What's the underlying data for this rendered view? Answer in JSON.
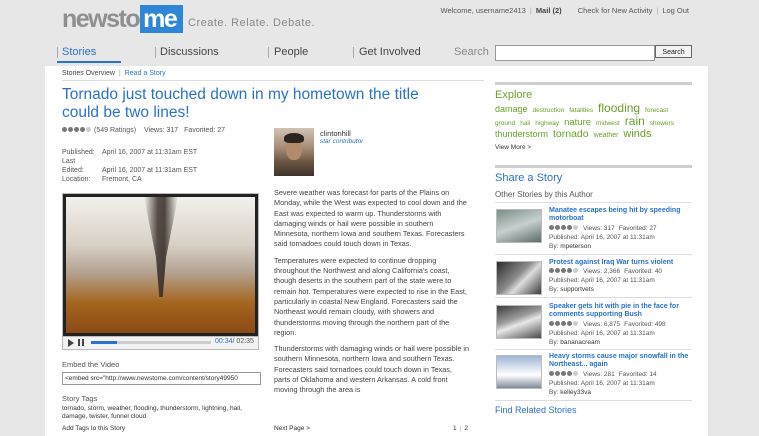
{
  "header": {
    "logo_part1": "newsto",
    "logo_part2": "me",
    "tagline": "Create. Relate. Debate.",
    "welcome": "Welcome, username2413",
    "mail": "Mail (2)",
    "check_activity": "Check for New Activity",
    "logout": "Log Out"
  },
  "nav": {
    "items": [
      "Stories",
      "Discussions",
      "People",
      "Get Involved"
    ],
    "search_label": "Search",
    "search_button": "Search",
    "search_value": ""
  },
  "breadcrumb": {
    "overview": "Stories Overview",
    "read": "Read a Story"
  },
  "article": {
    "title": "Tornado just touched down in my hometown the title could be two lines!",
    "rating_stars": 4,
    "ratings": "(549 Ratings)",
    "views": "Views: 317",
    "favorited": "Favorited: 27",
    "published_label": "Published:",
    "published": "April 16, 2007 at 11:31am EST",
    "edited_label": "Last Edited:",
    "edited": "April 16, 2007 at 11:31am EST",
    "location_label": "Location:",
    "location": "Fremont, CA",
    "author_name": "clintonhill",
    "author_title": "star contributor",
    "paragraphs": [
      "Severe weather was forecast for parts of the Plains on Monday, while the West was expected to cool down and the East was expected to warm up. Thunderstorms with damaging winds or hail were possible in southern Minnesota, northern Iowa and southern Texas. Forecasters said tornadoes could touch down in Texas.",
      "Temperatures were expected to continue dropping throughout the Northwest and along California's coast, though deserts in the southern part of the state were to remain hot. Temperatures were expected to rise in the East, particularly in coastal New England. Forecasters said the Northeast would remain cloudy, with showers and thunderstorms moving through the northern part of the region.",
      "Thunderstorms with damaging winds or hail were possible in southern Minnesota, northern Iowa and southern Texas. Forecasters said tornadoes could touch down in Texas, parts of Oklahoma and western Arkansas. A cold front moving through the area is"
    ],
    "next_page": "Next Page >",
    "pages": [
      "1",
      "2"
    ]
  },
  "video": {
    "current_time": "00:34",
    "duration": "/ 02:35",
    "progress": 0.22
  },
  "embed": {
    "label": "Embed the Video",
    "code": "<embed src=\"http://www.newstome.com/content/story49950"
  },
  "tags": {
    "label": "Story Tags",
    "list": "tornado, storm, weather, flooding, thunderstorm, lightning, hail, damage, twister, funnel cloud",
    "add_link": "Add Tags to this Story"
  },
  "explore": {
    "heading": "Explore",
    "cloud": [
      {
        "word": "damage",
        "size": 9
      },
      {
        "word": "destruction",
        "size": 6.5
      },
      {
        "word": "fatalities",
        "size": 6.5
      },
      {
        "word": "flooding",
        "size": 12
      },
      {
        "word": "forecast",
        "size": 6.5
      },
      {
        "word": "ground",
        "size": 6.5
      },
      {
        "word": "hail",
        "size": 6.5
      },
      {
        "word": "highway",
        "size": 6.5
      },
      {
        "word": "nature",
        "size": 9.5
      },
      {
        "word": "midwest",
        "size": 6.5
      },
      {
        "word": "rain",
        "size": 12
      },
      {
        "word": "showers",
        "size": 6.5
      },
      {
        "word": "thunderstorm",
        "size": 9
      },
      {
        "word": "tornado",
        "size": 10.5
      },
      {
        "word": "weather",
        "size": 7
      },
      {
        "word": "winds",
        "size": 11
      }
    ],
    "view_more": "View More >"
  },
  "share": {
    "heading": "Share a Story",
    "others_heading": "Other Stories by this Author"
  },
  "stories": [
    {
      "title": "Manatee escapes being hit by speeding motorboat",
      "rating_stars": 4,
      "views": "Views: 317",
      "favorited": "Favorited: 27",
      "published": "Published: April 16, 2007 at 11:31am",
      "by_label": "By:",
      "by": "mpeterson"
    },
    {
      "title": "Protest against Iraq War turns violent",
      "rating_stars": 4,
      "views": "Views: 2,366",
      "favorited": "Favorited: 40",
      "published": "Published: April 16, 2007 at 11:31am",
      "by_label": "By:",
      "by": "supportvets"
    },
    {
      "title": "Speaker gets hit with pie in the face for comments supporting Bush",
      "rating_stars": 4,
      "views": "Views: 6,875",
      "favorited": "Favorited: 498",
      "published": "Published: April 16, 2007 at 11:31am",
      "by_label": "By:",
      "by": "bananacream"
    },
    {
      "title": "Heavy storms cause major snowfall in the Northeast... again",
      "rating_stars": 4,
      "views": "Views: 281",
      "favorited": "Favorited: 14",
      "published": "Published: April 16, 2007 at 11:31am",
      "by_label": "By:",
      "by": "kelley33va"
    }
  ],
  "related": {
    "heading": "Find Related Stories"
  },
  "colors": {
    "accent_blue": "#2a72c8",
    "accent_green": "#6aa02b",
    "header_gray": "#e7e7e7"
  }
}
